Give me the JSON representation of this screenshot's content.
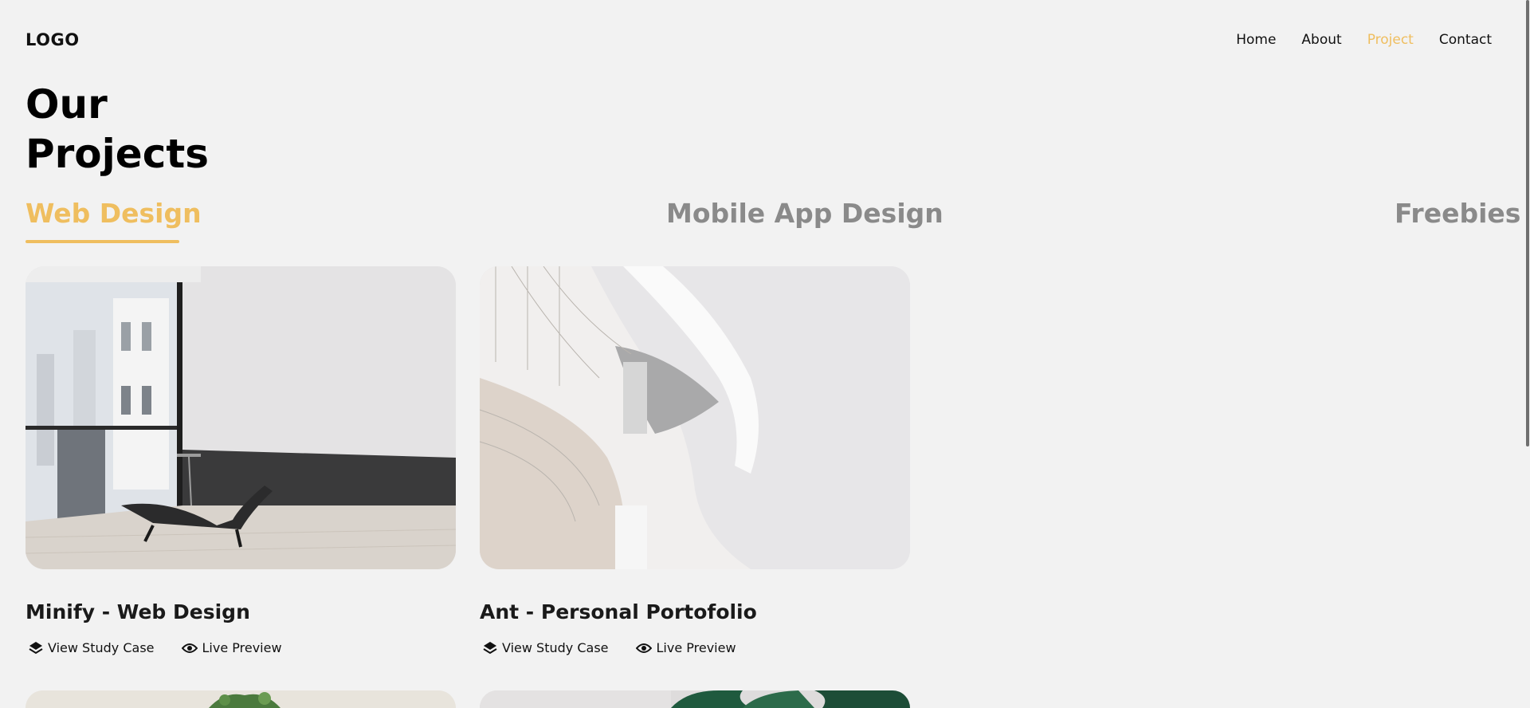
{
  "header": {
    "logo": "LOGO",
    "nav": [
      "Home",
      "About",
      "Project",
      "Contact"
    ],
    "active_nav": "Project"
  },
  "page": {
    "title": "Our\nProjects"
  },
  "tabs": [
    {
      "label": "Web Design",
      "active": true
    },
    {
      "label": "Mobile App Design",
      "active": false
    },
    {
      "label": "Freebies",
      "active": false
    }
  ],
  "projects": [
    {
      "title": "Minify - Web Design",
      "study_case": "View Study Case",
      "preview": "Live Preview",
      "image": "interior-chaise-lounge-window"
    },
    {
      "title": "Ant - Personal Portofolio",
      "study_case": "View Study Case",
      "preview": "Live Preview",
      "image": "white-curved-architecture"
    }
  ],
  "colors": {
    "accent": "#efbe5f",
    "background": "#f2f2f2",
    "inactive_tab": "#8a8a8a"
  }
}
